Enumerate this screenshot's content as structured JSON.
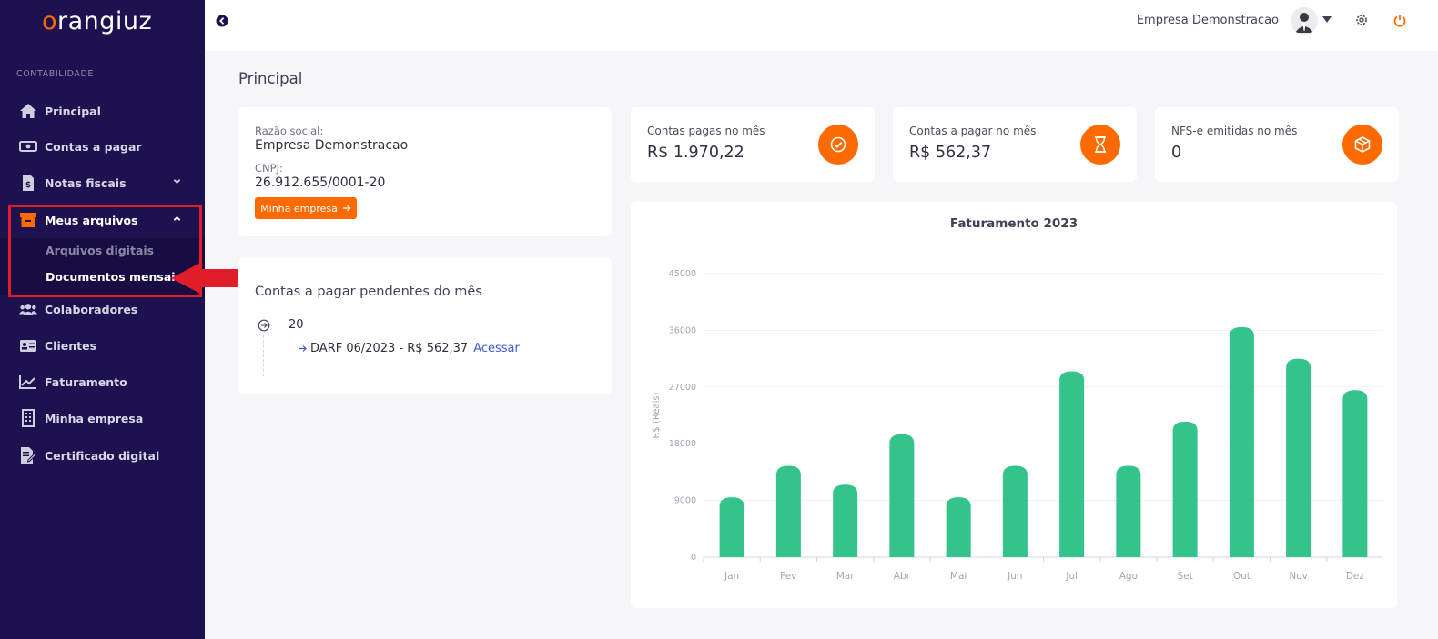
{
  "colors": {
    "sidebar_bg": "#1e1150",
    "accent": "#ff6a00",
    "bar": "#34c48b",
    "highlight": "#e21d2a",
    "link": "#3d5ad6"
  },
  "sidebar": {
    "logo_prefix": "o",
    "logo_rest": "rangiuz",
    "section": "CONTABILIDADE",
    "items": [
      {
        "label": "Principal",
        "icon": "home-icon"
      },
      {
        "label": "Contas a pagar",
        "icon": "money-icon"
      },
      {
        "label": "Notas fiscais",
        "icon": "invoice-icon"
      },
      {
        "label": "Meus arquivos",
        "icon": "archive-icon"
      },
      {
        "label": "Colaboradores",
        "icon": "users-icon"
      },
      {
        "label": "Clientes",
        "icon": "id-card-icon"
      },
      {
        "label": "Faturamento",
        "icon": "chart-line-icon"
      },
      {
        "label": "Minha empresa",
        "icon": "building-icon"
      },
      {
        "label": "Certificado digital",
        "icon": "certificate-icon"
      }
    ],
    "submenu": [
      "Arquivos digitais",
      "Documentos mensais"
    ]
  },
  "topbar": {
    "company": "Empresa Demonstracao"
  },
  "page": {
    "title": "Principal"
  },
  "company_card": {
    "razao_label": "Razão social:",
    "razao_value": "Empresa Demonstracao",
    "cnpj_label": "CNPJ:",
    "cnpj_value": "26.912.655/0001-20",
    "button": "Minha empresa"
  },
  "pending": {
    "title": "Contas a pagar pendentes do mês",
    "day": "20",
    "entry": "DARF 06/2023 - R$ 562,37",
    "link": "Acessar"
  },
  "stats": [
    {
      "label": "Contas pagas no mês",
      "value": "R$ 1.970,22",
      "icon": "check-circle-icon"
    },
    {
      "label": "Contas a pagar no mês",
      "value": "R$ 562,37",
      "icon": "hourglass-icon"
    },
    {
      "label": "NFS-e emitidas no mês",
      "value": "0",
      "icon": "box-icon"
    }
  ],
  "chart_data": {
    "type": "bar",
    "title": "Faturamento 2023",
    "ylabel": "R$ (Reais)",
    "xlabel": "",
    "categories": [
      "Jan",
      "Fev",
      "Mar",
      "Abr",
      "Mai",
      "Jun",
      "Jul",
      "Ago",
      "Set",
      "Out",
      "Nov",
      "Dez"
    ],
    "values": [
      9500,
      14500,
      11500,
      19500,
      9500,
      14500,
      29500,
      14500,
      21500,
      36500,
      31500,
      26500
    ],
    "ylim": [
      0,
      45000
    ],
    "yticks": [
      "0",
      "9000",
      "18000",
      "27000",
      "36000",
      "45000"
    ],
    "grid": true,
    "legend": "none"
  }
}
